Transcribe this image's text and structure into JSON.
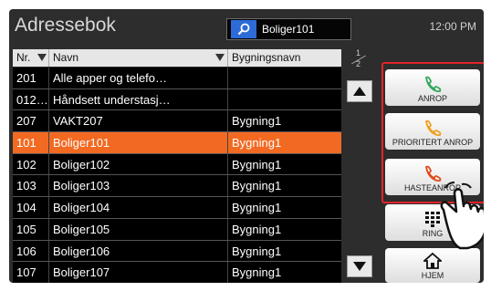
{
  "header": {
    "title": "Adressebok",
    "search_value": "Boliger101",
    "time": "12:00 PM"
  },
  "table": {
    "columns": [
      "Nr.",
      "Navn",
      "Bygningsnavn"
    ],
    "rows": [
      {
        "nr": "201",
        "navn": "Alle apper og telefo…",
        "bygning": ""
      },
      {
        "nr": "012…",
        "navn": "Håndsett understasj…",
        "bygning": ""
      },
      {
        "nr": "207",
        "navn": "VAKT207",
        "bygning": "Bygning1"
      },
      {
        "nr": "101",
        "navn": "Boliger101",
        "bygning": "Bygning1"
      },
      {
        "nr": "102",
        "navn": "Boliger102",
        "bygning": "Bygning1"
      },
      {
        "nr": "103",
        "navn": "Boliger103",
        "bygning": "Bygning1"
      },
      {
        "nr": "104",
        "navn": "Boliger104",
        "bygning": "Bygning1"
      },
      {
        "nr": "105",
        "navn": "Boliger105",
        "bygning": "Bygning1"
      },
      {
        "nr": "106",
        "navn": "Boliger106",
        "bygning": "Bygning1"
      },
      {
        "nr": "107",
        "navn": "Boliger107",
        "bygning": "Bygning1"
      }
    ],
    "selected_index": 3
  },
  "pager": {
    "current": "1",
    "total": "2"
  },
  "buttons": {
    "call": "ANROP",
    "priority_call": "PRIORITERT ANROP",
    "emergency_call": "HASTEANROP",
    "ring": "RING",
    "home": "HJEM"
  },
  "icons": {
    "search": "search-icon",
    "call": "phone-icon",
    "priority_call": "phone-icon",
    "emergency_call": "phone-icon",
    "ring": "keypad-icon",
    "home": "home-icon",
    "scroll_up": "arrow-up-icon",
    "scroll_down": "arrow-down-icon"
  },
  "colors": {
    "selected_row": "#f26a22",
    "call_icon": "#33a65a",
    "priority_icon": "#f0a020",
    "emergency_icon": "#e04a1a",
    "highlight_frame": "#e4222a",
    "search_icon_bg": "#2c6bd8"
  }
}
